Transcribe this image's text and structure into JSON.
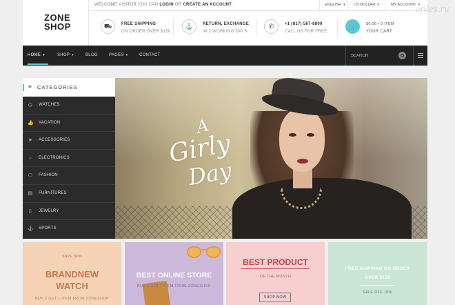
{
  "header": {
    "logo": {
      "line1": "ZONE",
      "line2": "SHOP"
    },
    "welcome": {
      "pre": "WELCOME VISITOR YOU CAN ",
      "login": "LOGIN",
      "mid": " OR ",
      "create": "CREATE AN ACCOUNT",
      "post": "."
    },
    "language": "ENGLISH",
    "currency": "US DOLLAR",
    "account": "MY ACCOUNT",
    "features": [
      {
        "icon": "truck-icon",
        "title": "FREE SHIPPING",
        "sub": "ON ORDER OVER $150"
      },
      {
        "icon": "anchor-icon",
        "title": "RETURN, EXCHANGE",
        "sub": "IN 2 WORKING DAYS"
      },
      {
        "icon": "phone-icon",
        "title": "+1 (817) 567-8800",
        "sub": "CALL US FOR FREE"
      }
    ],
    "cart": {
      "icon": "cart-icon",
      "title": "$0.00 • 0 ITEM",
      "sub": "YOUR CART"
    }
  },
  "nav": {
    "items": [
      "HOME",
      "SHOP",
      "BLOG",
      "PAGES",
      "CONTACT"
    ],
    "search_placeholder": "SEARCH"
  },
  "categories": {
    "title": "CATEGORIES",
    "items": [
      {
        "label": "WATCHES",
        "icon": "clock-icon"
      },
      {
        "label": "VACATION",
        "icon": "thumbs-up-icon"
      },
      {
        "label": "ACCESSORIES",
        "icon": "paper-plane-icon"
      },
      {
        "label": "ELECTRONICS",
        "icon": "circle-icon"
      },
      {
        "label": "FASHION",
        "icon": "tag-icon"
      },
      {
        "label": "FURNITURES",
        "icon": "film-icon"
      },
      {
        "label": "JEWELRY",
        "icon": "bag-icon"
      },
      {
        "label": "SPORTS",
        "icon": "anchor-icon"
      }
    ]
  },
  "hero": {
    "script_1": "A",
    "script_2": "Girly",
    "script_3": "Day"
  },
  "banners": [
    {
      "top": "SAVE 50%",
      "title1": "BRANDNEW",
      "title2": "WATCH",
      "sub": "BUY 2 GET 1 ITEM FROM ZONESHOP"
    },
    {
      "title": "BEST ONLINE STORE",
      "sub": "BUY 2 GET 1 ITEM FROM ZONESHOP"
    },
    {
      "title": "BEST PRODUCT",
      "sub": "OF THE MONTH",
      "button": "SHOP NOW"
    },
    {
      "title1": "FREE SHIPPING ON ORDER",
      "title2": "OVER $150",
      "sub": "SALE OFF 10%"
    }
  ],
  "watermark": "ofiles.ru",
  "colors": {
    "accent": "#5bc8d6",
    "nav_bg": "#222222",
    "sidebar_bg": "#2b2b2b"
  }
}
